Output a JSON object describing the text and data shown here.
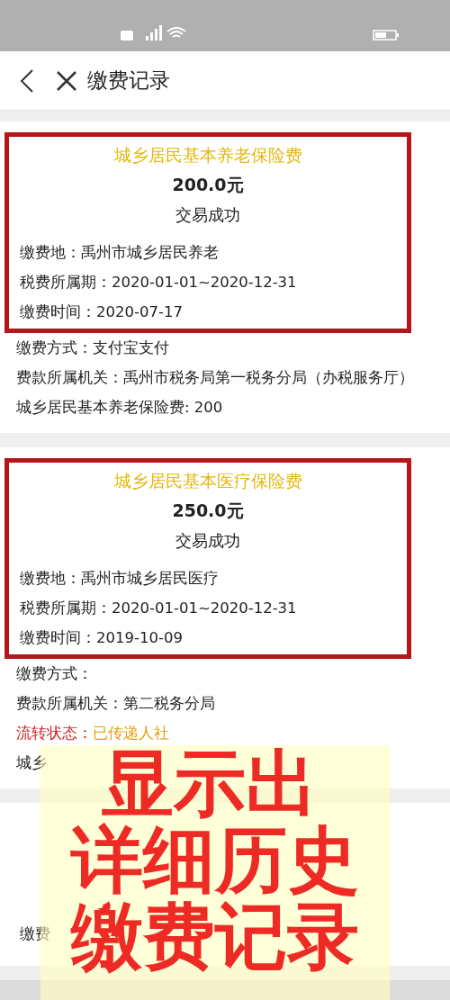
{
  "header": {
    "title": "缴费记录"
  },
  "cards": [
    {
      "highlighted": true,
      "title": "城乡居民基本养老保险费",
      "amount": "200.0元",
      "result": "交易成功",
      "fields": [
        {
          "kind": "plain",
          "text": "缴费地：禹州市城乡居民养老"
        },
        {
          "kind": "plain",
          "text": "税费所属期：2020-01-01~2020-12-31"
        },
        {
          "kind": "plain",
          "text": "缴费时间：2020-07-17"
        }
      ],
      "details": [
        {
          "kind": "plain",
          "text": "缴费方式：支付宝支付"
        },
        {
          "kind": "plain",
          "text": "费款所属机关：禹州市税务局第一税务分局（办税服务厅）"
        },
        {
          "kind": "plain",
          "text": "城乡居民基本养老保险费: 200"
        }
      ]
    },
    {
      "highlighted": true,
      "title": "城乡居民基本医疗保险费",
      "amount": "250.0元",
      "result": "交易成功",
      "fields": [
        {
          "kind": "plain",
          "text": "缴费地：禹州市城乡居民医疗"
        },
        {
          "kind": "plain",
          "text": "税费所属期：2020-01-01~2020-12-31"
        },
        {
          "kind": "plain",
          "text": "缴费时间：2019-10-09"
        }
      ],
      "details": [
        {
          "kind": "plain",
          "text": "缴费方式："
        },
        {
          "kind": "plain",
          "text": "费款所属机关：第二税务分局"
        },
        {
          "kind": "status",
          "label": "流转状态：",
          "text": "已传递人社"
        },
        {
          "kind": "plain",
          "text": "城乡"
        }
      ]
    },
    {
      "highlighted": false,
      "fields": [
        {
          "kind": "plain",
          "text": "缴费"
        }
      ]
    }
  ],
  "overlay": {
    "lines": [
      "显示出",
      "详细历史",
      "缴费记录"
    ]
  }
}
